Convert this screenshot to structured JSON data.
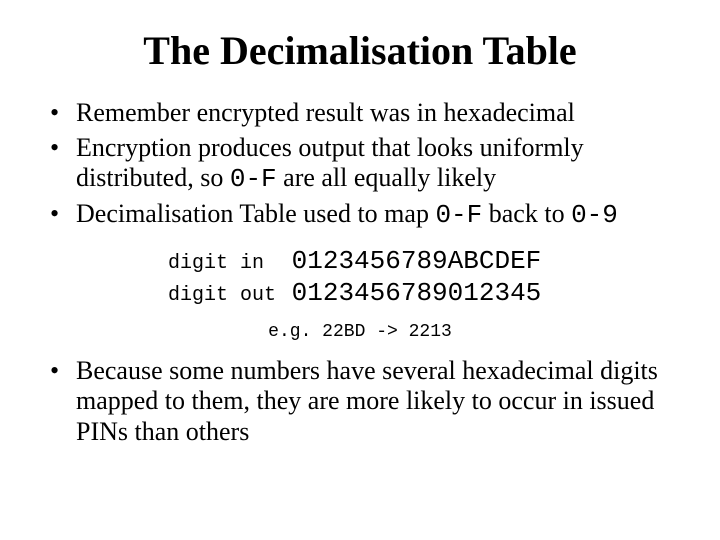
{
  "title": "The Decimalisation Table",
  "bullets": {
    "b1": "Remember encrypted result was in hexadecimal",
    "b2_pre": "Encryption produces output that looks uniformly distributed, so ",
    "b2_code": "0-F",
    "b2_post": " are all equally likely",
    "b3_pre": "Decimalisation Table used to map ",
    "b3_code1": "0-F",
    "b3_mid": " back to ",
    "b3_code2": "0-9",
    "b4": "Because some numbers have several hexadecimal digits mapped to them, they are more likely to occur in issued PINs than others"
  },
  "table": {
    "label_in": "digit in ",
    "value_in": " 0123456789ABCDEF",
    "label_out": "digit out",
    "value_out": " 0123456789012345"
  },
  "example": "e.g. 22BD -> 2213"
}
